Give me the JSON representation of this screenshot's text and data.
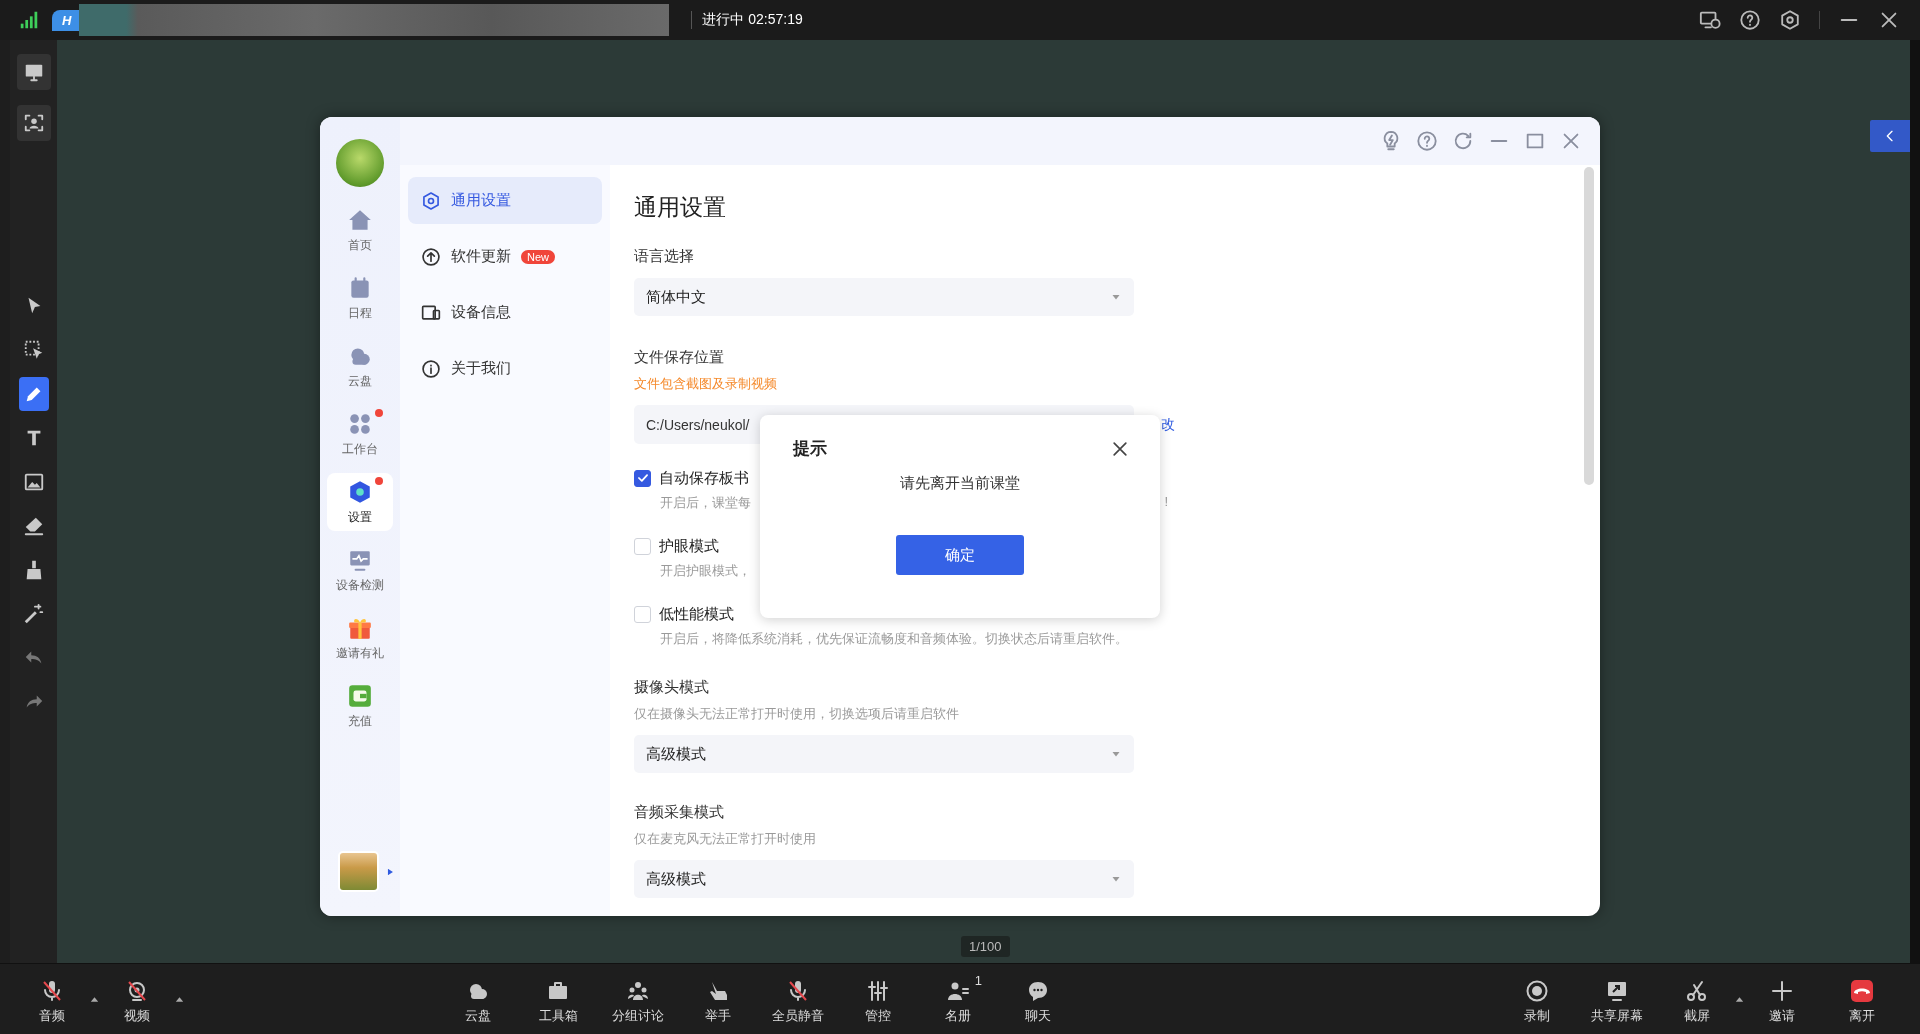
{
  "top_bar": {
    "app_tab": "H",
    "status": "进行中 02:57:19"
  },
  "toolbar_top": [
    {
      "kind": "board"
    },
    {
      "kind": "person-frame"
    }
  ],
  "toolbar_tools": [
    {
      "kind": "pointer",
      "selected": false
    },
    {
      "kind": "select-area",
      "selected": false
    },
    {
      "kind": "pen",
      "selected": true
    },
    {
      "kind": "text",
      "selected": false
    },
    {
      "kind": "image",
      "selected": false
    },
    {
      "kind": "eraser",
      "selected": false
    },
    {
      "kind": "broom",
      "selected": false
    },
    {
      "kind": "wand",
      "selected": false
    },
    {
      "kind": "undo",
      "selected": false
    },
    {
      "kind": "redo",
      "selected": false
    }
  ],
  "window": {
    "nav": [
      {
        "label": "首页",
        "kind": "home",
        "selected": false,
        "dot": false
      },
      {
        "label": "日程",
        "kind": "calendar",
        "selected": false,
        "dot": false
      },
      {
        "label": "云盘",
        "kind": "cloud",
        "selected": false,
        "dot": false
      },
      {
        "label": "工作台",
        "kind": "apps",
        "selected": false,
        "dot": true
      },
      {
        "label": "设置",
        "kind": "hex",
        "selected": true,
        "dot": true
      },
      {
        "label": "设备检测",
        "kind": "monitor-pulse",
        "selected": false,
        "dot": false
      },
      {
        "label": "邀请有礼",
        "kind": "gift",
        "selected": false,
        "dot": false
      },
      {
        "label": "充值",
        "kind": "wallet",
        "selected": false,
        "dot": false
      }
    ],
    "menu": [
      {
        "label": "通用设置",
        "kind": "gear",
        "selected": true
      },
      {
        "label": "软件更新",
        "kind": "upload",
        "selected": false,
        "badge": "New"
      },
      {
        "label": "设备信息",
        "kind": "device",
        "selected": false
      },
      {
        "label": "关于我们",
        "kind": "info",
        "selected": false
      }
    ],
    "content": {
      "title": "通用设置",
      "language": {
        "label": "语言选择",
        "value": "简体中文"
      },
      "save_location": {
        "label": "文件保存位置",
        "note": "文件包含截图及录制视频",
        "path": "C:/Users/neukol/",
        "change_link": "改"
      },
      "options": [
        {
          "label": "自动保存板书",
          "checked": true,
          "description": "开启后，课堂每",
          "description_tail": "!"
        },
        {
          "label": "护眼模式",
          "checked": false,
          "description": "开启护眼模式，"
        },
        {
          "label": "低性能模式",
          "checked": false,
          "description": "开启后，将降低系统消耗，优先保证流畅度和音频体验。切换状态后请重启软件。"
        }
      ],
      "camera": {
        "label": "摄像头模式",
        "hint": "仅在摄像头无法正常打开时使用，切换选项后请重启软件",
        "value": "高级模式"
      },
      "audio": {
        "label": "音频采集模式",
        "hint": "仅在麦克风无法正常打开时使用",
        "value": "高级模式"
      }
    },
    "dialog": {
      "title": "提示",
      "message": "请先离开当前课堂",
      "button": "确定"
    }
  },
  "page_indicator": "1/100",
  "bottom_bar": {
    "left": [
      {
        "label": "音频",
        "kind": "mic-off",
        "caret": true
      },
      {
        "label": "视频",
        "kind": "video-off",
        "caret": true
      }
    ],
    "center": [
      {
        "label": "云盘",
        "kind": "cloud"
      },
      {
        "label": "工具箱",
        "kind": "toolbox"
      },
      {
        "label": "分组讨论",
        "kind": "group"
      },
      {
        "label": "举手",
        "kind": "hand"
      },
      {
        "label": "全员静音",
        "kind": "mic-off"
      },
      {
        "label": "管控",
        "kind": "sliders"
      },
      {
        "label": "名册",
        "kind": "roster",
        "count": "1"
      },
      {
        "label": "聊天",
        "kind": "chat"
      }
    ],
    "right": [
      {
        "label": "录制",
        "kind": "record"
      },
      {
        "label": "共享屏幕",
        "kind": "share"
      },
      {
        "label": "截屏",
        "kind": "scissors",
        "caret": true
      },
      {
        "label": "邀请",
        "kind": "plus"
      },
      {
        "label": "离开",
        "kind": "hangup"
      }
    ]
  }
}
